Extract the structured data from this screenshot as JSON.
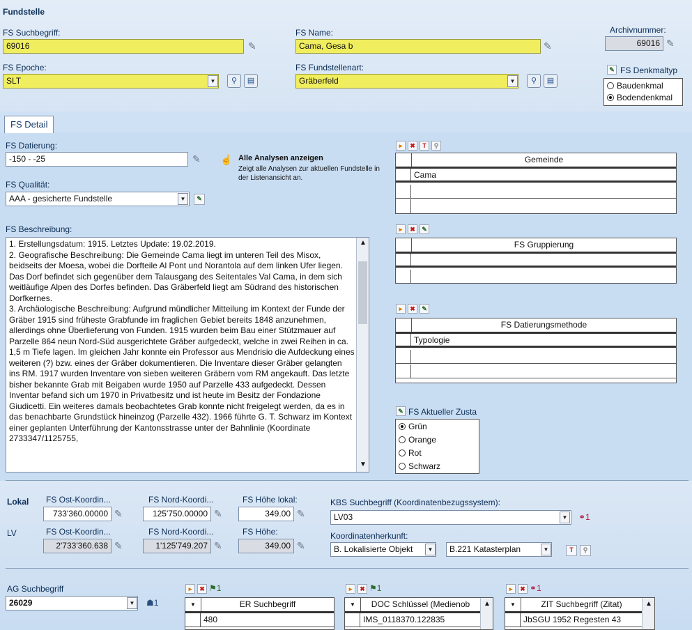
{
  "fundstelle": {
    "section_title": "Fundstelle",
    "suchbegriff_label": "FS Suchbegriff:",
    "suchbegriff_value": "69016",
    "name_label": "FS Name:",
    "name_value": "Cama, Gesa b",
    "archiv_label": "Archivnummer:",
    "archiv_value": "69016",
    "epoche_label": "FS Epoche:",
    "epoche_value": "SLT",
    "art_label": "FS Fundstellenart:",
    "art_value": "Gräberfeld",
    "denkmal_label": "FS Denkmaltyp",
    "denkmal_options": [
      "Baudenkmal",
      "Bodendenkmal"
    ],
    "denkmal_selected": "Bodendenkmal"
  },
  "tab": {
    "label": "FS Detail"
  },
  "detail": {
    "datierung_label": "FS Datierung:",
    "datierung_value": "-150 - -25",
    "analysen_title": "Alle Analysen anzeigen",
    "analysen_desc": "Zeigt alle Analysen zur aktuellen Fundstelle in der Listenansicht an.",
    "qualitaet_label": "FS Qualität:",
    "qualitaet_value": "AAA - gesicherte Fundstelle",
    "beschreibung_label": "FS Beschreibung:",
    "beschreibung_text": "1. Erstellungsdatum: 1915. Letztes Update: 19.02.2019.\n2. Geografische Beschreibung: Die Gemeinde Cama liegt im unteren Teil des Misox, beidseits der Moesa, wobei die Dorfteile Al Pont und Norantola auf dem linken Ufer liegen. Das Dorf befindet sich gegenüber dem Talausgang des Seitentales Val Cama, in dem sich weitläufige Alpen des Dorfes befinden. Das Gräberfeld liegt am Südrand des historischen Dorfkernes.\n3. Archäologische Beschreibung: Aufgrund mündlicher Mitteilung im Kontext der Funde der Gräber 1915 sind früheste Grabfunde im fraglichen Gebiet bereits 1848 anzunehmen, allerdings ohne Überlieferung von Funden. 1915 wurden beim Bau einer Stützmauer auf Parzelle 864 neun Nord-Süd ausgerichtete Gräber aufgedeckt, welche in zwei Reihen in ca. 1,5 m Tiefe lagen. Im gleichen Jahr konnte ein Professor aus Mendrisio die Aufdeckung eines weiteren (?) bzw. eines der Gräber dokumentieren. Die Inventare dieser Gräber gelangten ins RM. 1917 wurden Inventare von sieben weiteren Gräbern vom RM angekauft. Das letzte bisher bekannte Grab mit Beigaben wurde 1950 auf Parzelle 433 aufgedeckt. Dessen Inventar befand sich um 1970 in Privatbesitz und ist heute im Besitz der Fondazione Giudicetti. Ein weiteres damals beobachtetes Grab konnte nicht freigelegt werden, da es in das benachbarte Grundstück hineinzog (Parzelle 432). 1966 führte G. T. Schwarz im Kontext einer geplanten Unterführung der Kantonsstrasse unter der Bahnlinie (Koordinate 2733347/1125755,",
    "gemeinde_header": "Gemeinde",
    "gemeinde_rows": [
      "Cama",
      "",
      ""
    ],
    "gruppierung_header": "FS Gruppierung",
    "datierungsmethode_header": "FS Datierungsmethode",
    "datierungsmethode_rows": [
      "Typologie",
      "",
      "",
      ""
    ],
    "zustand_label": "FS Aktueller Zusta",
    "zustand_options": [
      "Grün",
      "Orange",
      "Rot",
      "Schwarz"
    ],
    "zustand_selected": "Grün"
  },
  "koordinaten": {
    "lokal_label": "Lokal",
    "lv_label": "LV",
    "ost_label": "FS Ost-Koordin...",
    "nord_label": "FS Nord-Koordi...",
    "hoehe_lokal_label": "FS Höhe lokal:",
    "hoehe_label": "FS Höhe:",
    "lokal_ost": "733'360.00000",
    "lokal_nord": "125'750.00000",
    "lokal_hoehe": "349.00",
    "lv_ost": "2'733'360.638",
    "lv_nord": "1'125'749.207",
    "lv_hoehe": "349.00",
    "kbs_label": "KBS Suchbegriff (Koordinatenbezugssystem):",
    "kbs_value": "LV03",
    "kbs_count": "1",
    "herkunft_label": "Koordinatenherkunft:",
    "herkunft_value": "B. Lokalisierte Objekt",
    "herkunft_detail": "B.221 Katasterplan"
  },
  "bottom": {
    "ag_label": "AG Suchbegriff",
    "ag_value": "26029",
    "ag_count": "1",
    "er_count": "1",
    "er_header": "ER Suchbegriff",
    "er_row": "480",
    "doc_count": "1",
    "doc_header": "DOC Schlüssel (Medienob",
    "doc_row": "IMS_0118370.122835",
    "zit_count": "1",
    "zit_header": "ZIT Suchbegriff (Zitat)",
    "zit_row": "JbSGU 1952 Regesten 43"
  }
}
